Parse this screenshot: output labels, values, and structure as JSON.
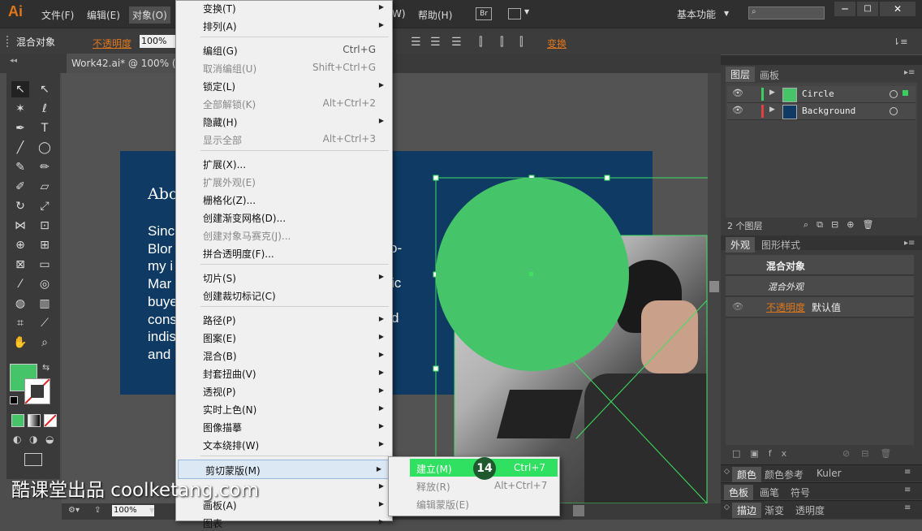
{
  "app": {
    "logo": "Ai"
  },
  "menubar": {
    "items": [
      "文件(F)",
      "编辑(E)",
      "对象(O)",
      "W)",
      "帮助(H)"
    ],
    "br": "Br",
    "workspace": "基本功能",
    "search_placeholder": ""
  },
  "controlbar": {
    "selection": "混合对象",
    "opacity_label": "不透明度",
    "opacity_value": "100%",
    "transform": "变换"
  },
  "document": {
    "tab": "Work42.ai* @ 100% (",
    "zoom": "100%"
  },
  "artboard": {
    "title": "Abo",
    "lines": [
      "Sinc",
      "Blor",
      "my i",
      "Mar",
      "buye",
      "cons",
      "indis",
      "and"
    ],
    "right_frags": [
      "o-",
      "ic",
      "d"
    ]
  },
  "object_menu": {
    "groups": [
      [
        {
          "label": "变换(T)",
          "shortcut": "",
          "sub": true,
          "disabled": false
        },
        {
          "label": "排列(A)",
          "shortcut": "",
          "sub": true,
          "disabled": false
        }
      ],
      [
        {
          "label": "编组(G)",
          "shortcut": "Ctrl+G",
          "sub": false,
          "disabled": false
        },
        {
          "label": "取消编组(U)",
          "shortcut": "Shift+Ctrl+G",
          "sub": false,
          "disabled": true
        },
        {
          "label": "锁定(L)",
          "shortcut": "",
          "sub": true,
          "disabled": false
        },
        {
          "label": "全部解锁(K)",
          "shortcut": "Alt+Ctrl+2",
          "sub": false,
          "disabled": true
        },
        {
          "label": "隐藏(H)",
          "shortcut": "",
          "sub": true,
          "disabled": false
        },
        {
          "label": "显示全部",
          "shortcut": "Alt+Ctrl+3",
          "sub": false,
          "disabled": true
        }
      ],
      [
        {
          "label": "扩展(X)...",
          "shortcut": "",
          "sub": false,
          "disabled": false
        },
        {
          "label": "扩展外观(E)",
          "shortcut": "",
          "sub": false,
          "disabled": true
        },
        {
          "label": "栅格化(Z)...",
          "shortcut": "",
          "sub": false,
          "disabled": false
        },
        {
          "label": "创建渐变网格(D)...",
          "shortcut": "",
          "sub": false,
          "disabled": false
        },
        {
          "label": "创建对象马赛克(J)...",
          "shortcut": "",
          "sub": false,
          "disabled": true
        },
        {
          "label": "拼合透明度(F)...",
          "shortcut": "",
          "sub": false,
          "disabled": false
        }
      ],
      [
        {
          "label": "切片(S)",
          "shortcut": "",
          "sub": true,
          "disabled": false
        },
        {
          "label": "创建裁切标记(C)",
          "shortcut": "",
          "sub": false,
          "disabled": false
        }
      ],
      [
        {
          "label": "路径(P)",
          "shortcut": "",
          "sub": true,
          "disabled": false
        },
        {
          "label": "图案(E)",
          "shortcut": "",
          "sub": true,
          "disabled": false
        },
        {
          "label": "混合(B)",
          "shortcut": "",
          "sub": true,
          "disabled": false
        },
        {
          "label": "封套扭曲(V)",
          "shortcut": "",
          "sub": true,
          "disabled": false
        },
        {
          "label": "透视(P)",
          "shortcut": "",
          "sub": true,
          "disabled": false
        },
        {
          "label": "实时上色(N)",
          "shortcut": "",
          "sub": true,
          "disabled": false
        },
        {
          "label": "图像描摹",
          "shortcut": "",
          "sub": true,
          "disabled": false
        },
        {
          "label": "文本绕排(W)",
          "shortcut": "",
          "sub": true,
          "disabled": false
        }
      ],
      [
        {
          "label": "剪切蒙版(M)",
          "shortcut": "",
          "sub": true,
          "disabled": false,
          "active": true
        },
        {
          "label": "",
          "shortcut": "",
          "sub": true,
          "disabled": false
        },
        {
          "label": "画板(A)",
          "shortcut": "",
          "sub": true,
          "disabled": false
        },
        {
          "label": "图表",
          "shortcut": "",
          "sub": true,
          "disabled": false
        }
      ]
    ]
  },
  "clip_submenu": {
    "items": [
      {
        "label": "建立(M)",
        "shortcut": "Ctrl+7",
        "disabled": false
      },
      {
        "label": "释放(R)",
        "shortcut": "Alt+Ctrl+7",
        "disabled": true
      },
      {
        "label": "编辑蒙版(E)",
        "shortcut": "",
        "disabled": true
      }
    ],
    "step_badge": "14"
  },
  "layers_panel": {
    "tabs": [
      "图层",
      "画板"
    ],
    "layers": [
      {
        "name": "Circle",
        "color": "#3ad060"
      },
      {
        "name": "Background",
        "color": "#e04040"
      }
    ],
    "count": "2 个图层"
  },
  "appearance_panel": {
    "tabs": [
      "外观",
      "图形样式"
    ],
    "object": "混合对象",
    "sub": "混合外观",
    "opacity_label": "不透明度",
    "opacity_value": "默认值"
  },
  "bottom_panels": {
    "row1": [
      "颜色",
      "颜色参考",
      "Kuler"
    ],
    "row2": [
      "色板",
      "画笔",
      "符号"
    ],
    "row3": [
      "描边",
      "渐变",
      "透明度"
    ]
  },
  "colors": {
    "fill": "#46c46a",
    "accent": "#e0761b",
    "highlight": "#30e060",
    "artboard": "#0f3a63"
  },
  "watermark": "酷课堂出品 coolketang.com"
}
